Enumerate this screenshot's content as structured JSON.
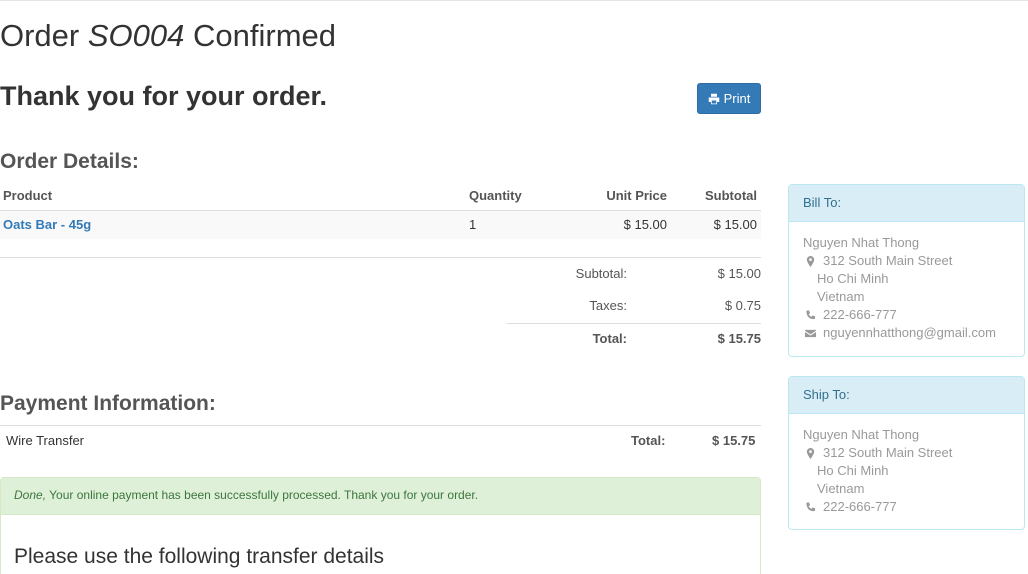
{
  "header": {
    "title_prefix": "Order",
    "order_number": "SO004",
    "title_suffix": "Confirmed",
    "thanks": "Thank you for your order.",
    "print_label": "Print"
  },
  "order": {
    "section_title": "Order Details:",
    "columns": {
      "product": "Product",
      "quantity": "Quantity",
      "unit_price": "Unit Price",
      "subtotal": "Subtotal"
    },
    "lines": [
      {
        "product": "Oats Bar - 45g",
        "quantity": "1",
        "unit_price": "$ 15.00",
        "subtotal": "$ 15.00"
      }
    ],
    "summary": {
      "subtotal_label": "Subtotal:",
      "subtotal_value": "$ 15.00",
      "taxes_label": "Taxes:",
      "taxes_value": "$ 0.75",
      "total_label": "Total:",
      "total_value": "$ 15.75"
    }
  },
  "payment": {
    "section_title": "Payment Information:",
    "method": "Wire Transfer",
    "total_label": "Total:",
    "total_value": "$ 15.75",
    "alert_status": "Done,",
    "alert_message": "Your online payment has been successfully processed. Thank you for your order.",
    "transfer_title": "Please use the following transfer details"
  },
  "bill_to": {
    "title": "Bill To:",
    "name": "Nguyen Nhat Thong",
    "street": "312 South Main Street",
    "city": "Ho Chi Minh",
    "country": "Vietnam",
    "phone": "222-666-777",
    "email": "nguyennhatthong@gmail.com"
  },
  "ship_to": {
    "title": "Ship To:",
    "name": "Nguyen Nhat Thong",
    "street": "312 South Main Street",
    "city": "Ho Chi Minh",
    "country": "Vietnam",
    "phone": "222-666-777"
  },
  "colors": {
    "primary": "#337ab7",
    "success_bg": "#dff0d8",
    "info_bg": "#d9edf7"
  }
}
